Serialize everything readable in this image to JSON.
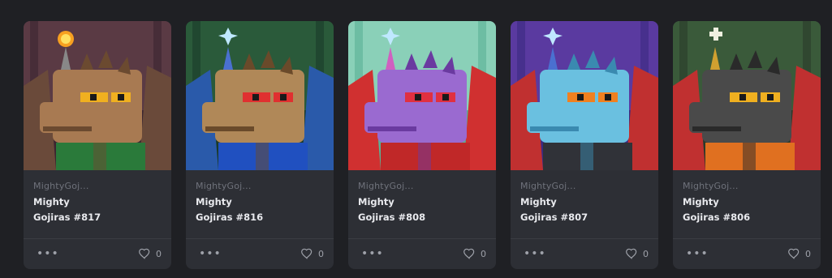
{
  "cards": [
    {
      "collection": "MightyGoj...",
      "name_line1": "Mighty",
      "name_line2": "Gojiras #817",
      "likes": "0",
      "colors": {
        "bg1": "#5a3a44",
        "bg2": "#3b2530",
        "skin": "#a87a52",
        "skin_dark": "#6b4a30",
        "wing": "#6a4a3a",
        "eye": "#f0b020",
        "outfit": "#2a7a3a",
        "horn": "#888888",
        "hat": "fire"
      }
    },
    {
      "collection": "MightyGoj...",
      "name_line1": "Mighty",
      "name_line2": "Gojiras #816",
      "likes": "0",
      "colors": {
        "bg1": "#2a5a3a",
        "bg2": "#1a3a2a",
        "skin": "#b08858",
        "skin_dark": "#6a4a2a",
        "wing": "#2a5aaa",
        "eye": "#e03030",
        "outfit": "#2050c0",
        "horn": "#4a70d0",
        "hat": "sparkle"
      }
    },
    {
      "collection": "MightyGoj...",
      "name_line1": "Mighty",
      "name_line2": "Gojiras #808",
      "likes": "0",
      "colors": {
        "bg1": "#8ad0b8",
        "bg2": "#5ab094",
        "skin": "#9a6ad0",
        "skin_dark": "#6a3aa0",
        "wing": "#d03030",
        "eye": "#e03040",
        "outfit": "#c02828",
        "horn": "#d060c0",
        "hat": "sparkle"
      }
    },
    {
      "collection": "MightyGoj...",
      "name_line1": "Mighty",
      "name_line2": "Gojiras #807",
      "likes": "0",
      "colors": {
        "bg1": "#5a3aa0",
        "bg2": "#3a2a80",
        "skin": "#6ac0e0",
        "skin_dark": "#3a8ab0",
        "wing": "#c03030",
        "eye": "#f08020",
        "outfit": "#303238",
        "horn": "#4a70d0",
        "hat": "sparkle"
      }
    },
    {
      "collection": "MightyGoj...",
      "name_line1": "Mighty",
      "name_line2": "Gojiras #806",
      "likes": "0",
      "colors": {
        "bg1": "#3a5a3a",
        "bg2": "#2a3a2a",
        "skin": "#4a4a4a",
        "skin_dark": "#2a2a2a",
        "wing": "#c03030",
        "eye": "#f0b020",
        "outfit": "#e07020",
        "horn": "#d0a030",
        "hat": "cross"
      }
    }
  ]
}
